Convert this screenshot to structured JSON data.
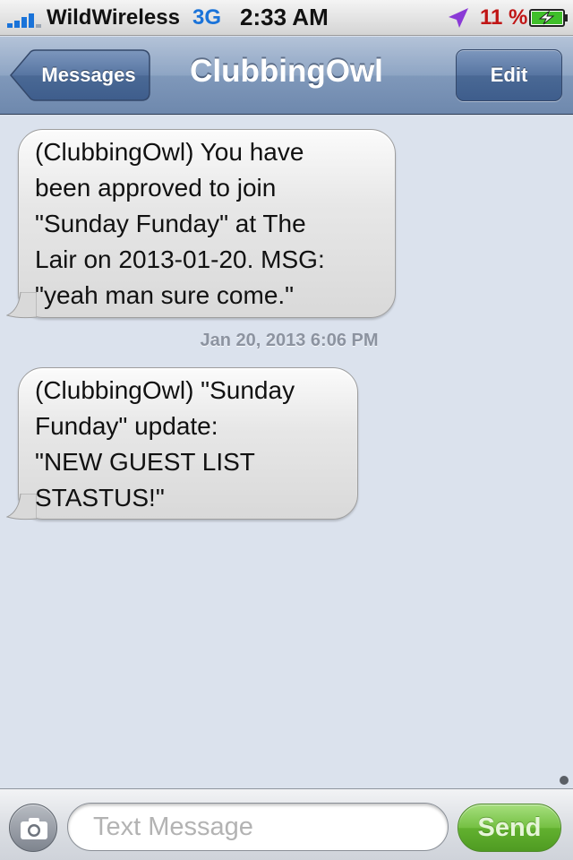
{
  "status_bar": {
    "carrier": "WildWireless",
    "network": "3G",
    "time": "2:33 AM",
    "battery_percent": "11 %",
    "signal_bars": 4,
    "icons": [
      "signal-bars-icon",
      "location-arrow-icon",
      "battery-charging-icon"
    ],
    "colors": {
      "network": "#1a73d9",
      "battery_text": "#c01515",
      "location": "#8a3ad6",
      "battery_fill": "#3fbf2a"
    }
  },
  "nav": {
    "back_label": "Messages",
    "title": "ClubbingOwl",
    "edit_label": "Edit"
  },
  "conversation": {
    "messages": [
      {
        "sender": "received",
        "text": "(ClubbingOwl) You have\nbeen approved to join\n\"Sunday Funday\" at The\nLair on 2013-01-20. MSG:\n\"yeah man sure come.\""
      },
      {
        "sender": "received",
        "text": "(ClubbingOwl) \"Sunday\nFunday\" update:\n\"NEW GUEST LIST\nSTASTUS!\""
      }
    ],
    "timestamp": "Jan 20, 2013 6:06 PM"
  },
  "compose": {
    "placeholder": "Text Message",
    "send_label": "Send",
    "camera_icon": "camera-icon",
    "colors": {
      "send_button": "#62b12f"
    }
  }
}
